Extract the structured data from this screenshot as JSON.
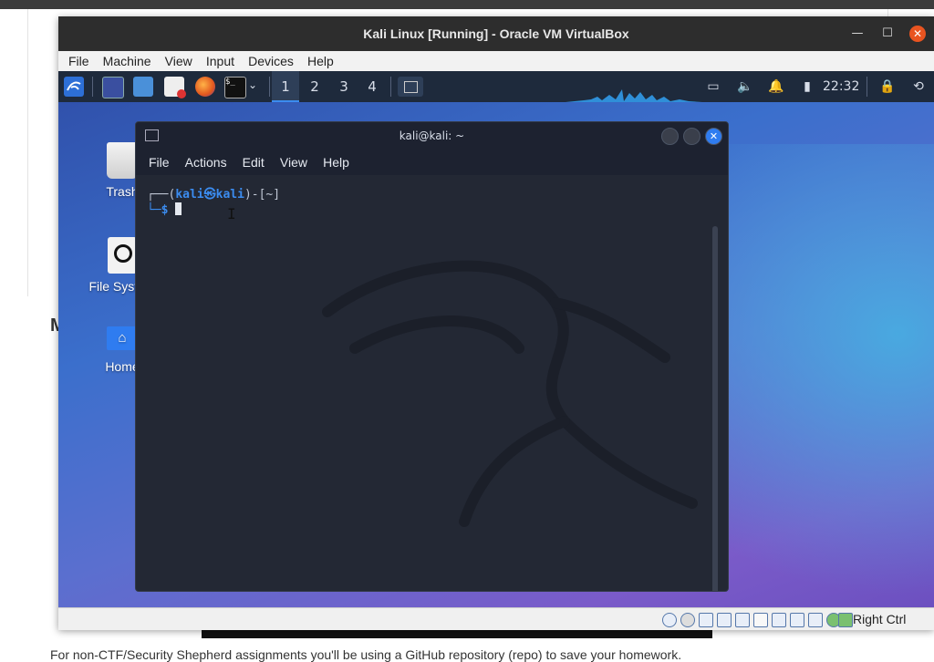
{
  "background_page": {
    "heading_fragment": "M",
    "paragraph": "For non-CTF/Security Shepherd assignments you'll be using a GitHub repository (repo) to save your homework."
  },
  "window": {
    "title": "Kali Linux [Running] - Oracle VM VirtualBox",
    "controls": [
      "minimize",
      "maximize",
      "close"
    ],
    "menu": [
      "File",
      "Machine",
      "View",
      "Input",
      "Devices",
      "Help"
    ]
  },
  "guest": {
    "taskbar": {
      "workspaces": [
        "1",
        "2",
        "3",
        "4"
      ],
      "active_workspace": "1",
      "clock": "22:32"
    },
    "desktop_icons": [
      {
        "label": "Trash",
        "icon": "trash-icon"
      },
      {
        "label": "File System",
        "icon": "drive-icon"
      },
      {
        "label": "Home",
        "icon": "home-icon"
      }
    ],
    "terminal": {
      "title": "kali@kali: ~",
      "menu": [
        "File",
        "Actions",
        "Edit",
        "View",
        "Help"
      ],
      "prompt_line1_prefix": "┌──(",
      "prompt_user": "kali㉿kali",
      "prompt_line1_suffix": ")-[~]",
      "prompt_line2": "└─$ "
    }
  },
  "statusbar": {
    "host_key": "Right Ctrl"
  },
  "colors": {
    "accent": "#3b8cf0",
    "close_orange": "#e95420",
    "terminal_bg": "#232834"
  }
}
